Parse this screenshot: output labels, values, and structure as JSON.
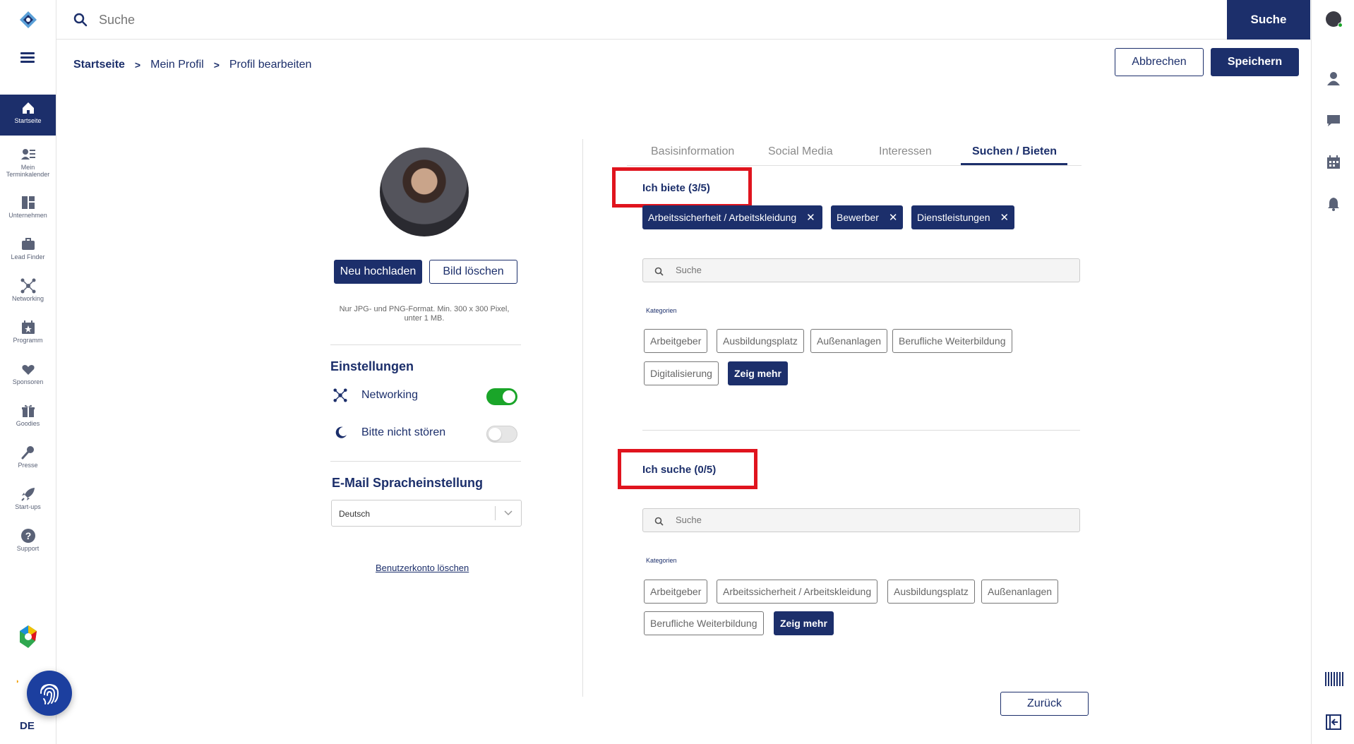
{
  "topbar": {
    "search_placeholder": "Suche",
    "search_button": "Suche"
  },
  "sidebar": {
    "items": [
      {
        "label": "Startseite",
        "icon": "home-icon"
      },
      {
        "label": "Mein Terminkalender",
        "icon": "calendar-people-icon"
      },
      {
        "label": "Unternehmen",
        "icon": "companies-icon"
      },
      {
        "label": "Lead Finder",
        "icon": "briefcase-icon"
      },
      {
        "label": "Networking",
        "icon": "network-icon"
      },
      {
        "label": "Programm",
        "icon": "program-icon"
      },
      {
        "label": "Sponsoren",
        "icon": "heart-hand-icon"
      },
      {
        "label": "Goodies",
        "icon": "gift-icon"
      },
      {
        "label": "Presse",
        "icon": "microphone-icon"
      },
      {
        "label": "Start-ups",
        "icon": "rocket-icon"
      },
      {
        "label": "Support",
        "icon": "help-icon"
      }
    ],
    "language": "DE"
  },
  "breadcrumb": {
    "home": "Startseite",
    "profile": "Mein Profil",
    "current": "Profil bearbeiten"
  },
  "actions": {
    "cancel": "Abbrechen",
    "save": "Speichern",
    "back": "Zurück"
  },
  "profile": {
    "upload": "Neu hochladen",
    "delete_image": "Bild löschen",
    "note": "Nur JPG- und PNG-Format. Min. 300 x 300 Pixel, unter 1 MB."
  },
  "settings": {
    "title": "Einstellungen",
    "networking_label": "Networking",
    "networking_on": true,
    "dnd_label": "Bitte nicht stören",
    "dnd_on": false
  },
  "email_lang": {
    "title": "E-Mail Spracheinstellung",
    "value": "Deutsch"
  },
  "delete_account": "Benutzerkonto löschen",
  "tabs": [
    "Basisinformation",
    "Social Media",
    "Interessen",
    "Suchen / Bieten"
  ],
  "offer": {
    "title": "Ich biete (3/5)",
    "selected": [
      "Arbeitssicherheit / Arbeitskleidung",
      "Bewerber",
      "Dienstleistungen"
    ],
    "search_placeholder": "Suche",
    "categories_label": "Kategorien",
    "categories": [
      "Arbeitgeber",
      "Ausbildungsplatz",
      "Außenanlagen",
      "Berufliche Weiterbildung",
      "Digitalisierung"
    ],
    "more": "Zeig mehr"
  },
  "seek": {
    "title": "Ich suche (0/5)",
    "search_placeholder": "Suche",
    "categories_label": "Kategorien",
    "categories": [
      "Arbeitgeber",
      "Arbeitssicherheit / Arbeitskleidung",
      "Ausbildungsplatz",
      "Außenanlagen",
      "Berufliche Weiterbildung"
    ],
    "more": "Zeig mehr"
  },
  "colors": {
    "primary": "#1c2f6b",
    "toggle_on": "#1aa529",
    "highlight": "#e0141e"
  }
}
